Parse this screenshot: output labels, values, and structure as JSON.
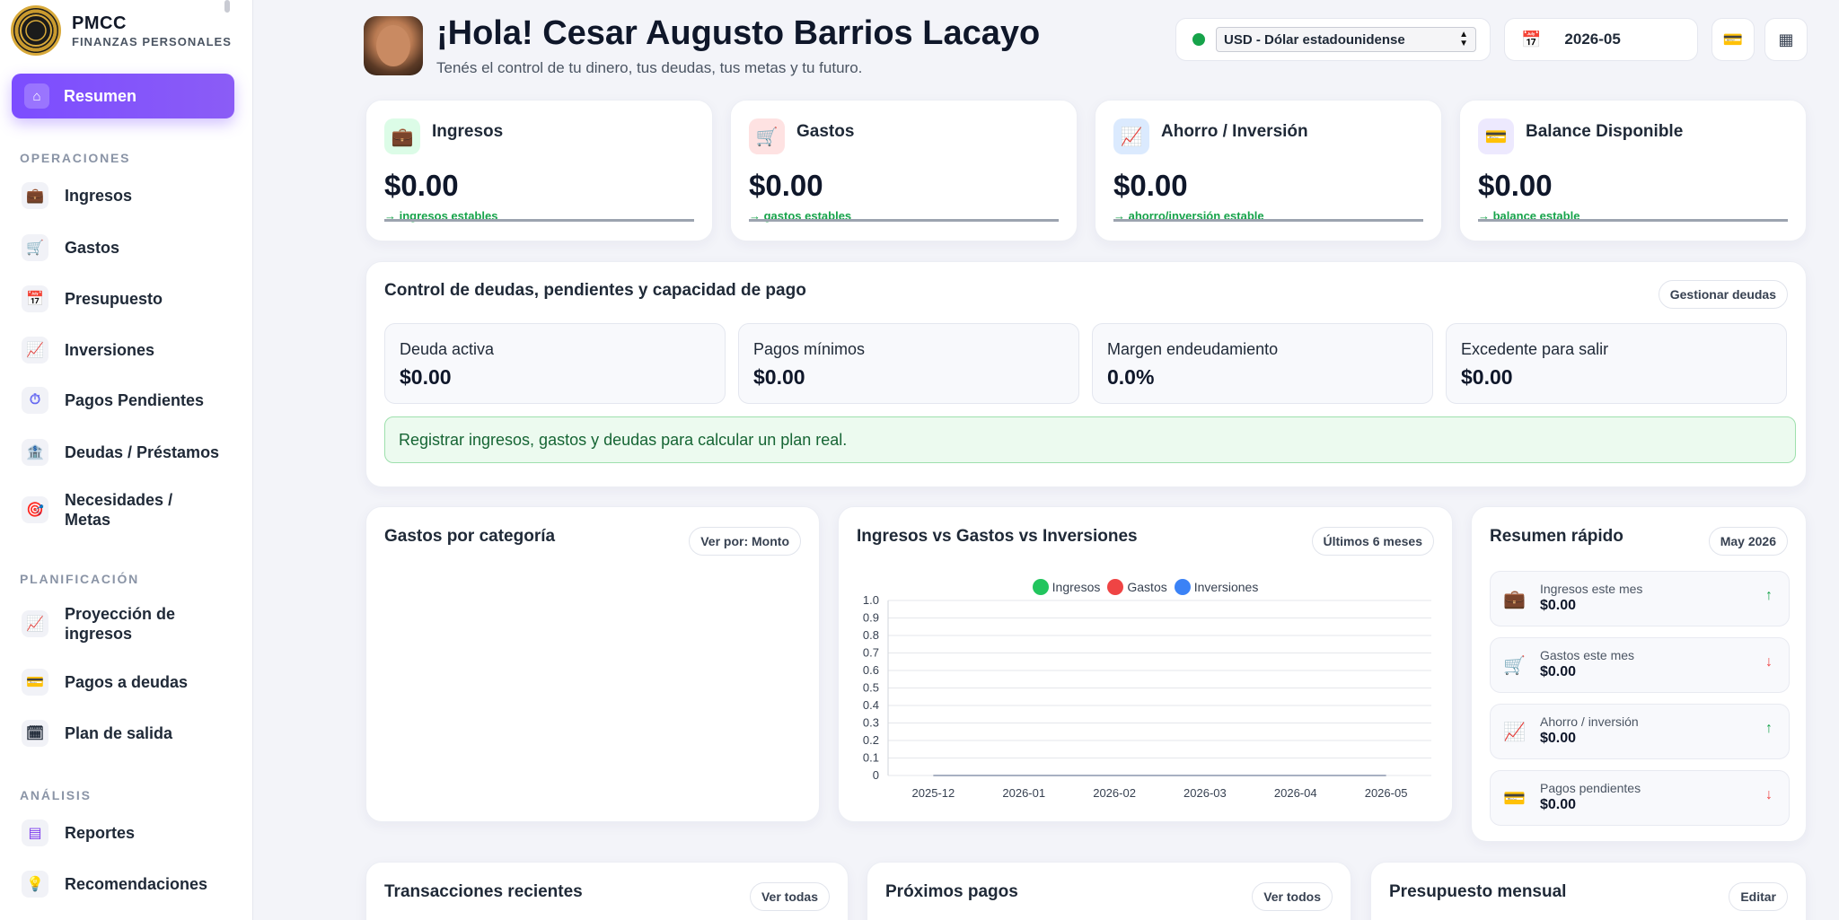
{
  "sidebar": {
    "brand_name": "PMCC",
    "brand_sub": "FINANZAS PERSONALES",
    "active_item": "Resumen",
    "sections": {
      "operaciones": "OPERACIONES",
      "planificacion": "PLANIFICACIÓN",
      "analisis": "ANÁLISIS"
    },
    "items": {
      "ingresos": "Ingresos",
      "gastos": "Gastos",
      "presupuesto": "Presupuesto",
      "inversiones": "Inversiones",
      "pagos_pendientes": "Pagos Pendientes",
      "deudas": "Deudas / Préstamos",
      "necesidades": "Necesidades / Metas",
      "proyeccion": "Proyección de ingresos",
      "pagos_deudas": "Pagos a deudas",
      "plan_salida": "Plan de salida",
      "reportes": "Reportes",
      "recomendaciones": "Recomendaciones"
    }
  },
  "header": {
    "greeting": "¡Hola! Cesar Augusto Barrios Lacayo",
    "subtitle": "Tenés el control de tu dinero, tus deudas, tus metas y tu futuro.",
    "currency": "USD - Dólar estadounidense",
    "period": "2026-05"
  },
  "stats": [
    {
      "title": "Ingresos",
      "value": "$0.00",
      "note": "→ ingresos estables",
      "color": "#dcfce7"
    },
    {
      "title": "Gastos",
      "value": "$0.00",
      "note": "→ gastos estables",
      "color": "#fee2e2"
    },
    {
      "title": "Ahorro / Inversión",
      "value": "$0.00",
      "note": "→ ahorro/inversión estable",
      "color": "#dbeafe"
    },
    {
      "title": "Balance Disponible",
      "value": "$0.00",
      "note": "→ balance estable",
      "color": "#ede9fe"
    }
  ],
  "debt": {
    "title": "Control de deudas, pendientes y capacidad de pago",
    "manage_button": "Gestionar deudas",
    "boxes": [
      {
        "label": "Deuda activa",
        "value": "$0.00"
      },
      {
        "label": "Pagos mínimos",
        "value": "$0.00"
      },
      {
        "label": "Margen endeudamiento",
        "value": "0.0%"
      },
      {
        "label": "Excedente para salir",
        "value": "$0.00"
      }
    ],
    "alert": "Registrar ingresos, gastos y deudas para calcular un plan real."
  },
  "gastos_categoria": {
    "title": "Gastos por categoría",
    "view_button": "Ver por: Monto"
  },
  "comparison": {
    "title": "Ingresos vs Gastos vs Inversiones",
    "range_button": "Últimos 6 meses"
  },
  "chart_data": {
    "type": "line",
    "x": [
      "2025-12",
      "2026-01",
      "2026-02",
      "2026-03",
      "2026-04",
      "2026-05"
    ],
    "series": [
      {
        "name": "Ingresos",
        "values": [
          0,
          0,
          0,
          0,
          0,
          0
        ],
        "color": "#22c55e"
      },
      {
        "name": "Gastos",
        "values": [
          0,
          0,
          0,
          0,
          0,
          0
        ],
        "color": "#ef4444"
      },
      {
        "name": "Inversiones",
        "values": [
          0,
          0,
          0,
          0,
          0,
          0
        ],
        "color": "#3b82f6"
      }
    ],
    "yticks": [
      "0",
      "0.1",
      "0.2",
      "0.3",
      "0.4",
      "0.5",
      "0.6",
      "0.7",
      "0.8",
      "0.9",
      "1.0"
    ],
    "ylim": [
      0,
      1
    ],
    "grid": true,
    "legend": "top-center"
  },
  "quick_summary": {
    "title": "Resumen rápido",
    "period_button": "May 2026",
    "items": [
      {
        "label": "Ingresos este mes",
        "value": "$0.00",
        "arrow": "↑",
        "color": "#16a34a"
      },
      {
        "label": "Gastos este mes",
        "value": "$0.00",
        "arrow": "↓",
        "color": "#ef4444"
      },
      {
        "label": "Ahorro / inversión",
        "value": "$0.00",
        "arrow": "↑",
        "color": "#16a34a"
      },
      {
        "label": "Pagos pendientes",
        "value": "$0.00",
        "arrow": "↓",
        "color": "#ef4444"
      }
    ]
  },
  "bottom": {
    "transactions_title": "Transacciones recientes",
    "transactions_button": "Ver todas",
    "upcoming_title": "Próximos pagos",
    "upcoming_button": "Ver todos",
    "budget_title": "Presupuesto mensual",
    "budget_button": "Editar"
  }
}
